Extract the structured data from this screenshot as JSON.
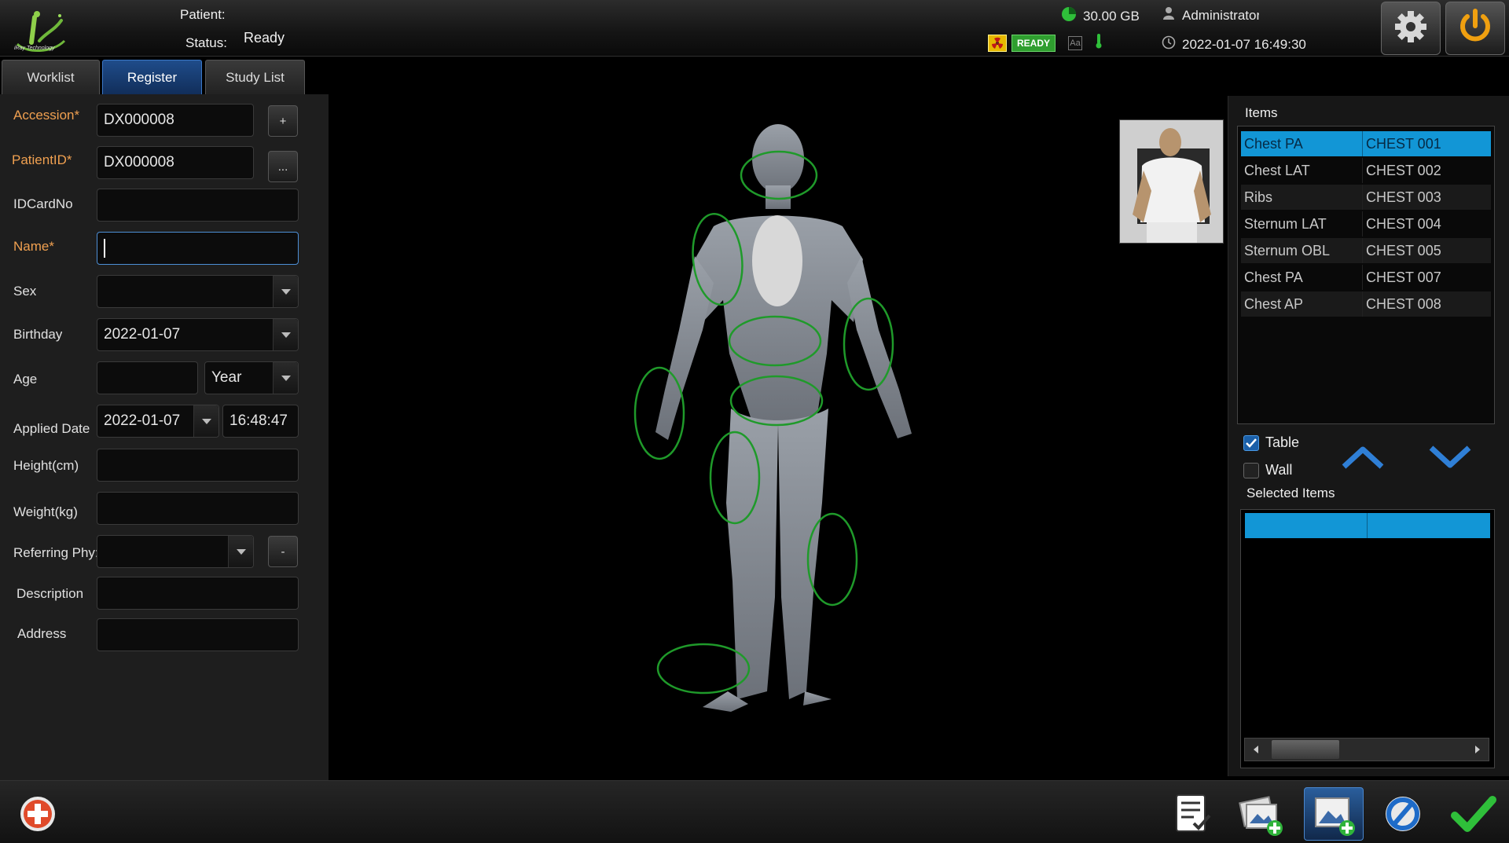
{
  "header": {
    "patient_label": "Patient:",
    "status_label": "Status:",
    "status_value": "Ready",
    "disk_space": "30.00 GB",
    "user": "Administrator",
    "datetime": "2022-01-07 16:49:30",
    "ready_badge": "READY",
    "font_icon_text": "Aa",
    "logo_text": "iRay Technology"
  },
  "tabs": [
    {
      "label": "Worklist"
    },
    {
      "label": "Register"
    },
    {
      "label": "Study List"
    }
  ],
  "form": {
    "accession": {
      "label": "Accession*",
      "value": "DX000008",
      "button": "+"
    },
    "patient_id": {
      "label": "PatientID*",
      "value": "DX000008",
      "button": "..."
    },
    "id_card": {
      "label": "IDCardNo",
      "value": ""
    },
    "name": {
      "label": "Name*",
      "value": ""
    },
    "sex": {
      "label": "Sex",
      "value": ""
    },
    "birthday": {
      "label": "Birthday",
      "value": "2022-01-07"
    },
    "age": {
      "label": "Age",
      "value": "",
      "unit": "Year"
    },
    "applied_date": {
      "label": "Applied Date",
      "date": "2022-01-07",
      "time": "16:48:47"
    },
    "height": {
      "label": "Height(cm)",
      "value": ""
    },
    "weight": {
      "label": "Weight(kg)",
      "value": ""
    },
    "referring": {
      "label": "Referring Phy:",
      "value": "",
      "button": "-"
    },
    "description": {
      "label": "Description",
      "value": ""
    },
    "address": {
      "label": "Address",
      "value": ""
    }
  },
  "items": {
    "title": "Items",
    "rows": [
      {
        "name": "Chest PA",
        "code": "CHEST 001"
      },
      {
        "name": "Chest LAT",
        "code": "CHEST 002"
      },
      {
        "name": "Ribs",
        "code": "CHEST 003"
      },
      {
        "name": "Sternum LAT",
        "code": "CHEST 004"
      },
      {
        "name": "Sternum OBL",
        "code": "CHEST 005"
      },
      {
        "name": "Chest PA",
        "code": "CHEST 007"
      },
      {
        "name": "Chest AP",
        "code": "CHEST 008"
      }
    ]
  },
  "options": {
    "table": "Table",
    "wall": "Wall",
    "selected_title": "Selected Items"
  },
  "colors": {
    "accent": "#1296d6",
    "required_label": "#f0a050",
    "region_outline": "#1f9a2a",
    "ready_green": "#2f9e2f"
  }
}
